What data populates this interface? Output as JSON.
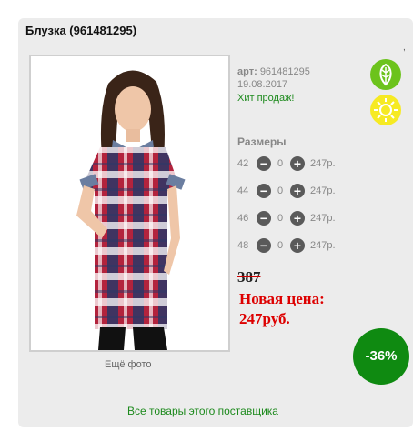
{
  "product": {
    "title": "Блузка (961481295)",
    "tick": ",",
    "art_label": "арт:",
    "art_value": "961481295",
    "date": "19.08.2017",
    "hit": "Хит продаж!",
    "more_photo": "Ещё фото"
  },
  "badges": {
    "eco_icon": "leaf-icon",
    "eco_color": "#6cc31c",
    "sun_icon": "sun-icon",
    "sun_color": "#f6ea23"
  },
  "sizes": {
    "title": "Размеры",
    "items": [
      {
        "size": "42",
        "qty": "0",
        "price": "247р."
      },
      {
        "size": "44",
        "qty": "0",
        "price": "247р."
      },
      {
        "size": "46",
        "qty": "0",
        "price": "247р."
      },
      {
        "size": "48",
        "qty": "0",
        "price": "247р."
      }
    ]
  },
  "pricing": {
    "old_price": "387",
    "new_label": "Новая цена:",
    "new_value": "247руб.",
    "discount": "-36%",
    "discount_color": "#0f8a11"
  },
  "footer": {
    "all_goods": "Все товары этого поставщика"
  }
}
